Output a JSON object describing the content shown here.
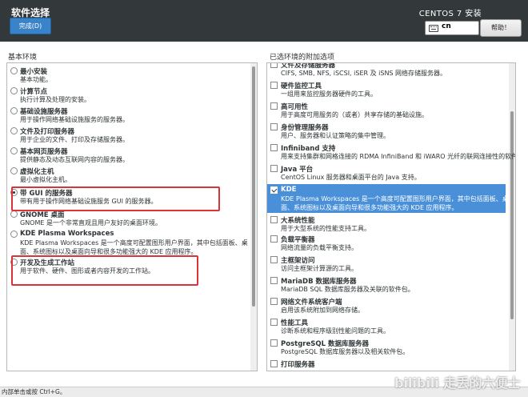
{
  "header": {
    "title": "软件选择",
    "done_label": "完成(D)",
    "product": "CENTOS 7 安装",
    "keyboard_layout": "cn",
    "help_label": "帮助！"
  },
  "base_env": {
    "heading": "基本环境",
    "items": [
      {
        "title": "最小安装",
        "desc": [
          "基本功能。"
        ],
        "selected": false
      },
      {
        "title": "计算节点",
        "desc": [
          "执行计算及处理的安装。"
        ],
        "selected": false
      },
      {
        "title": "基础设施服务器",
        "desc": [
          "用于操作网络基础设施服务的服务器。"
        ],
        "selected": false
      },
      {
        "title": "文件及打印服务器",
        "desc": [
          "用于企业的文件、打印及存储服务器。"
        ],
        "selected": false
      },
      {
        "title": "基本网页服务器",
        "desc": [
          "提供静态及动态互联网内容的服务器。"
        ],
        "selected": false
      },
      {
        "title": "虚拟化主机",
        "desc": [
          "最小虚拟化主机。"
        ],
        "selected": false
      },
      {
        "title": "带 GUI 的服务器",
        "desc": [
          "带有用于操作网络基础设施服务 GUI 的服务器。"
        ],
        "selected": true
      },
      {
        "title": "GNOME 桌面",
        "desc": [
          "GNOME 是一个非常直观且用户友好的桌面环境。"
        ],
        "selected": false
      },
      {
        "title": "KDE Plasma Workspaces",
        "desc": [
          "KDE Plasma Workspaces 是一个高度可配置图形用户界面，其中包括面板、桌",
          "面、系统图标以及桌面向导和很多功能强大的 KDE 应用程序。"
        ],
        "selected": false
      },
      {
        "title": "开发及生成工作站",
        "desc": [
          "用于软件、硬件、图形或者内容开发的工作站。"
        ],
        "selected": false
      }
    ]
  },
  "addons": {
    "heading": "已选环境的附加选项",
    "items": [
      {
        "title": "文件及存储服务器",
        "desc": [
          "CIFS, SMB, NFS, iSCSI, iSER 及 iSNS 网络存储服务器。"
        ],
        "checked": false
      },
      {
        "title": "硬件监控工具",
        "desc": [
          "一组用来监控服务器硬件的工具。"
        ],
        "checked": false
      },
      {
        "title": "高可用性",
        "desc": [
          "用于高度可用服务的（或者）共享存储的基础设施。"
        ],
        "checked": false
      },
      {
        "title": "身份管理服务器",
        "desc": [
          "用户、服务器和认证策略的集中管理。"
        ],
        "checked": false
      },
      {
        "title": "Infiniband 支持",
        "desc": [
          "用来支持集群和网格连接的 RDMA InfiniBand 和 iWARO 光纤的联网连接性的软件。"
        ],
        "checked": false
      },
      {
        "title": "Java 平台",
        "desc": [
          "CentOS Linux 服务器和桌面平台的 Java 支持。"
        ],
        "checked": false
      },
      {
        "title": "KDE",
        "desc": [
          "KDE Plasma Workspaces 是一个高度可配置图形用户界面，其中包括面板、桌",
          "面、系统图标以及桌面向导和很多功能强大的 KDE 应用程序。"
        ],
        "checked": true
      },
      {
        "title": "大系统性能",
        "desc": [
          "用于大型系统的性能支持工具。"
        ],
        "checked": false
      },
      {
        "title": "负载平衡器",
        "desc": [
          "网络流量的负载平衡支持。"
        ],
        "checked": false
      },
      {
        "title": "主框架访问",
        "desc": [
          "访问主框架计算源的工具。"
        ],
        "checked": false
      },
      {
        "title": "MariaDB 数据库服务器",
        "desc": [
          "MariaDB SQL 数据库服务器及关联的软件包。"
        ],
        "checked": false
      },
      {
        "title": "网络文件系统客户端",
        "desc": [
          "启用该系统附加到网络存储。"
        ],
        "checked": false
      },
      {
        "title": "性能工具",
        "desc": [
          "诊断系统和程序级别性能问题的工具。"
        ],
        "checked": false
      },
      {
        "title": "PostgreSQL 数据库服务器",
        "desc": [
          "PostgreSQL 数据库服务器以及相关软件包。"
        ],
        "checked": false
      },
      {
        "title": "打印服务器",
        "desc": [
          ""
        ],
        "checked": false
      }
    ]
  },
  "status_bar": "内部单击或按 Ctrl+G。",
  "watermark": "bilibili 走丢的六便士"
}
